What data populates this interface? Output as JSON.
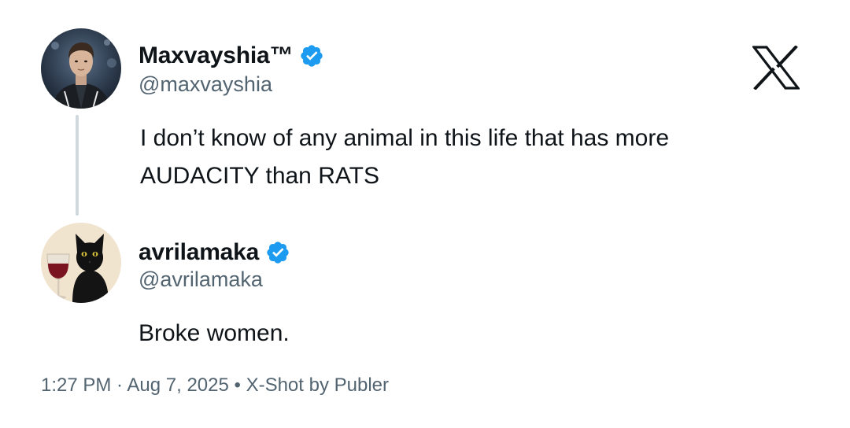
{
  "tweet": {
    "author": {
      "display_name": "Maxvayshia™",
      "handle": "@maxvayshia",
      "verified": true,
      "avatar_icon": "avatar-man-portrait"
    },
    "text_lines": [
      "I don’t know of any animal in this life that has more",
      "AUDACITY than RATS"
    ]
  },
  "reply": {
    "author": {
      "display_name": "avrilamaka",
      "handle": "@avrilamaka",
      "verified": true,
      "avatar_icon": "avatar-black-cat-wine"
    },
    "text": "Broke women."
  },
  "footer": {
    "text": "1:27 PM · Aug 7, 2025 • X-Shot by Publer"
  },
  "colors": {
    "verified_blue": "#1d9bf0",
    "text_primary": "#0f1419",
    "text_secondary": "#536471",
    "thread_line": "#cfd9de"
  },
  "brand_icon": "x-logo-icon"
}
